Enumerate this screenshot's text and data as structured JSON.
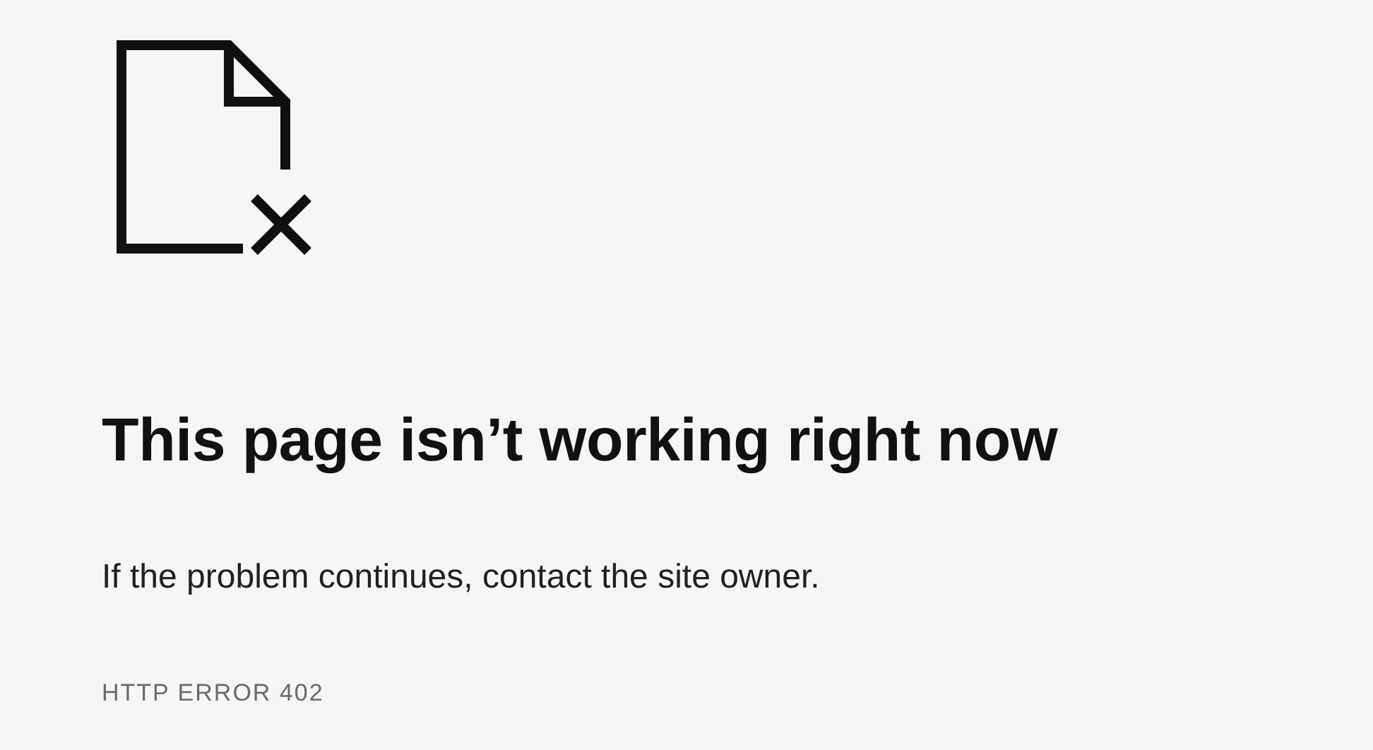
{
  "heading": "This page isn’t working right now",
  "message": "If the problem continues, contact the site owner.",
  "error_code": "HTTP ERROR 402"
}
